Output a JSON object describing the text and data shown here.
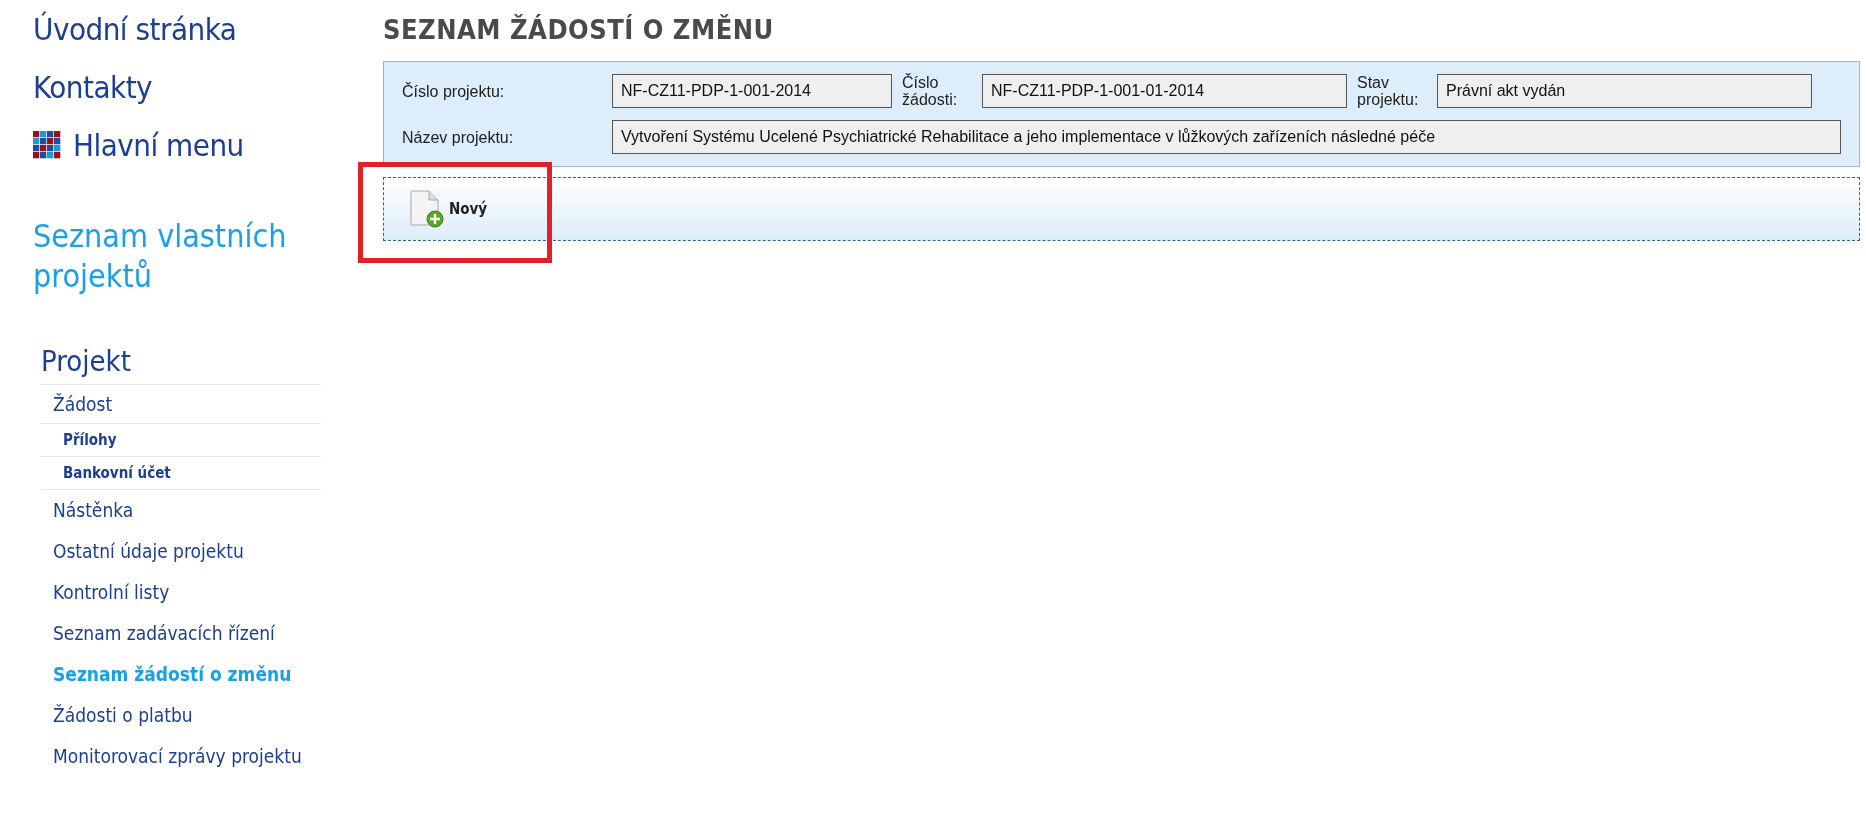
{
  "sidebar": {
    "top_links": [
      "Úvodní stránka",
      "Kontakty"
    ],
    "main_menu": "Hlavní menu",
    "own_projects": "Seznam vlastních projektů",
    "section_title": "Projekt",
    "items": [
      {
        "label": "Žádost",
        "selected": false,
        "children": [
          {
            "label": "Přílohy",
            "selected": false
          },
          {
            "label": "Bankovní účet",
            "selected": false
          }
        ]
      },
      {
        "label": "Nástěnka",
        "selected": false
      },
      {
        "label": "Ostatní údaje projektu",
        "selected": false
      },
      {
        "label": "Kontrolní listy",
        "selected": false
      },
      {
        "label": "Seznam zadávacích řízení",
        "selected": false
      },
      {
        "label": "Seznam žádostí o změnu",
        "selected": true
      },
      {
        "label": "Žádosti o platbu",
        "selected": false
      },
      {
        "label": "Monitorovací zprávy projektu",
        "selected": false
      }
    ]
  },
  "page_title": "SEZNAM ŽÁDOSTÍ O ZMĚNU",
  "info": {
    "row_1": [
      {
        "label": "Číslo projektu:",
        "value": "NF-CZ11-PDP-1-001-2014"
      },
      {
        "label": "Číslo žádosti:",
        "value": "NF-CZ11-PDP-1-001-01-2014"
      },
      {
        "label": "Stav projektu:",
        "value": "Právní akt vydán"
      }
    ],
    "row_2": {
      "label": "Název projektu:",
      "value": "Vytvoření Systému Ucelené Psychiatrické Rehabilitace a jeho implementace v lůžkových zařízeních následné péče"
    }
  },
  "toolbar": {
    "new_button": "Nový"
  }
}
